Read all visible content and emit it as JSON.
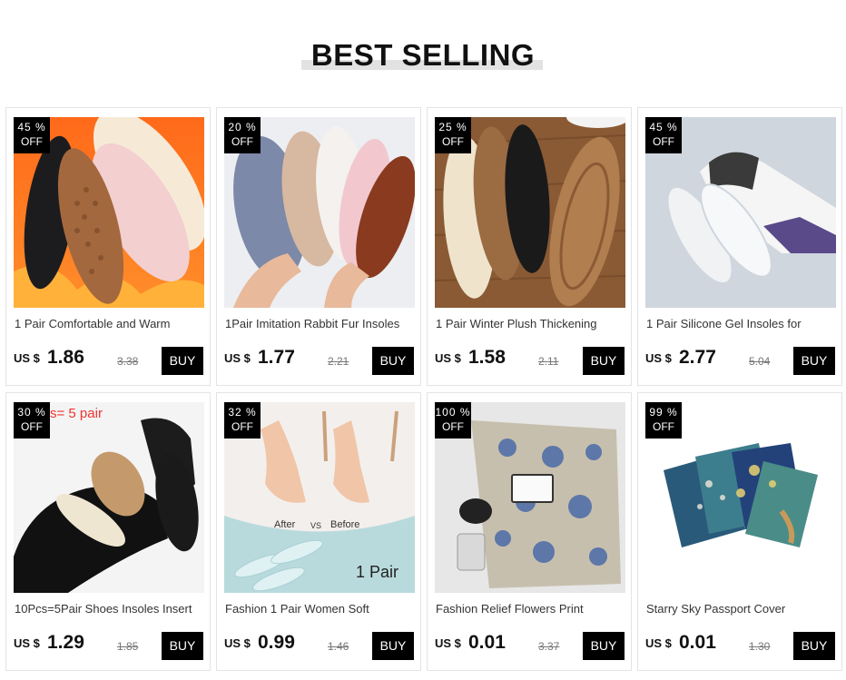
{
  "section_title": "BEST SELLING",
  "products": [
    {
      "badge_pct": "45 %",
      "badge_off": "OFF",
      "name": "1 Pair Comfortable and Warm",
      "currency": "US $",
      "price": "1.86",
      "old_price": "3.38",
      "buy_label": "BUY"
    },
    {
      "badge_pct": "20 %",
      "badge_off": "OFF",
      "name": "1Pair Imitation Rabbit Fur Insoles",
      "currency": "US $",
      "price": "1.77",
      "old_price": "2.21",
      "buy_label": "BUY"
    },
    {
      "badge_pct": "25 %",
      "badge_off": "OFF",
      "name": "1 Pair Winter Plush Thickening",
      "currency": "US $",
      "price": "1.58",
      "old_price": "2.11",
      "buy_label": "BUY"
    },
    {
      "badge_pct": "45 %",
      "badge_off": "OFF",
      "name": "1 Pair Silicone Gel Insoles for",
      "currency": "US $",
      "price": "2.77",
      "old_price": "5.04",
      "buy_label": "BUY"
    },
    {
      "badge_pct": "30 %",
      "badge_off": "OFF",
      "name": "10Pcs=5Pair Shoes Insoles Insert",
      "currency": "US $",
      "price": "1.29",
      "old_price": "1.85",
      "buy_label": "BUY",
      "image_text": "s= 5 pair"
    },
    {
      "badge_pct": "32 %",
      "badge_off": "OFF",
      "name": "Fashion 1 Pair Women Soft",
      "currency": "US $",
      "price": "0.99",
      "old_price": "1.46",
      "buy_label": "BUY",
      "image_after": "After",
      "image_vs": "VS",
      "image_before": "Before",
      "image_pair": "1 Pair"
    },
    {
      "badge_pct": "100 %",
      "badge_off": "OFF",
      "name": "Fashion Relief Flowers Print",
      "currency": "US $",
      "price": "0.01",
      "old_price": "3.37",
      "buy_label": "BUY"
    },
    {
      "badge_pct": "99 %",
      "badge_off": "OFF",
      "name": "Starry Sky Passport Cover",
      "currency": "US $",
      "price": "0.01",
      "old_price": "1.30",
      "buy_label": "BUY"
    }
  ]
}
